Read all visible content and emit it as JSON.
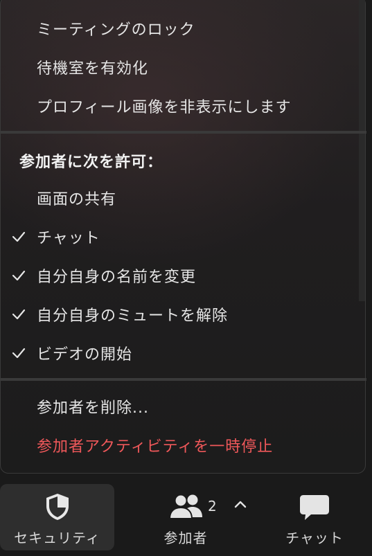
{
  "menu": {
    "items_top": [
      {
        "label": "ミーティングのロック",
        "checked": false
      },
      {
        "label": "待機室を有効化",
        "checked": false
      },
      {
        "label": "プロフィール画像を非表示にします",
        "checked": false
      }
    ],
    "allow_heading": "参加者に次を許可：",
    "allow_items": [
      {
        "label": "画面の共有",
        "checked": false
      },
      {
        "label": "チャット",
        "checked": true
      },
      {
        "label": "自分自身の名前を変更",
        "checked": true
      },
      {
        "label": "自分自身のミュートを解除",
        "checked": true
      },
      {
        "label": "ビデオの開始",
        "checked": true
      }
    ],
    "remove_participant": "参加者を削除...",
    "suspend_activity": "参加者アクティビティを一時停止"
  },
  "toolbar": {
    "security_label": "セキュリティ",
    "participants_label": "参加者",
    "participants_count": "2",
    "chat_label": "チャット"
  },
  "colors": {
    "accent_red": "#f0585a",
    "text": "#e6e6e6",
    "background": "#1a1a1a"
  },
  "icons": {
    "security": "shield-icon",
    "participants": "people-icon",
    "caret": "chevron-up-icon",
    "chat": "chat-bubble-icon",
    "check": "checkmark-icon"
  }
}
